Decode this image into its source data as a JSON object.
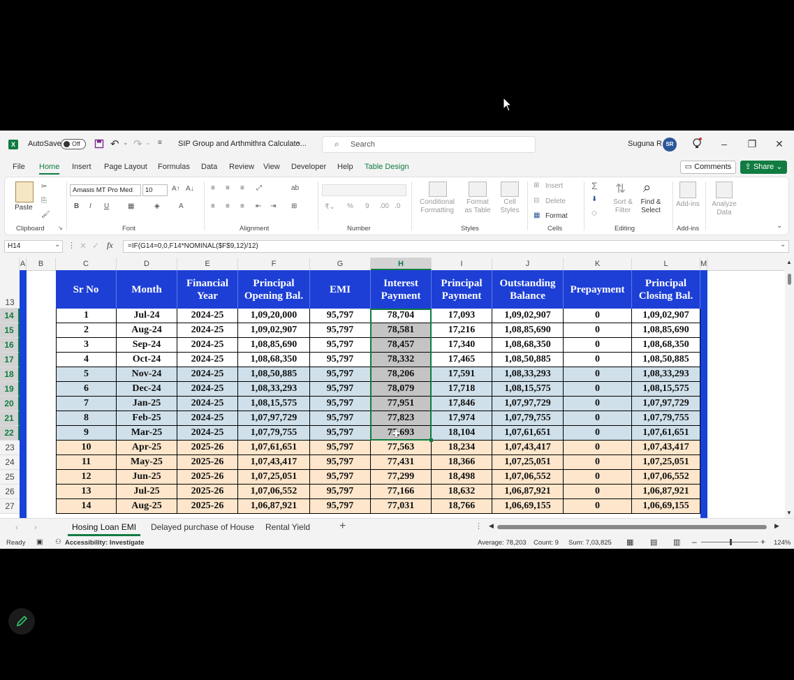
{
  "window": {
    "autosave_label": "AutoSave",
    "autosave_state": "Off",
    "file_title": "SIP Group and Arthmithra Calculato...",
    "search_placeholder": "Search",
    "user_name": "Suguna R",
    "user_initials": "SR"
  },
  "menu": {
    "items": [
      "File",
      "Home",
      "Insert",
      "Page Layout",
      "Formulas",
      "Data",
      "Review",
      "View",
      "Developer",
      "Help",
      "Table Design"
    ],
    "comments": "Comments",
    "share": "Share"
  },
  "ribbon": {
    "clipboard": {
      "label": "Clipboard",
      "paste": "Paste"
    },
    "font": {
      "label": "Font",
      "font_name": "Amasis MT Pro Med",
      "font_size": "10"
    },
    "alignment": {
      "label": "Alignment"
    },
    "number": {
      "label": "Number"
    },
    "styles": {
      "label": "Styles",
      "conditional": "Conditional Formatting",
      "format_table": "Format as Table",
      "cell_styles": "Cell Styles"
    },
    "cells": {
      "label": "Cells",
      "insert": "Insert",
      "delete": "Delete",
      "format": "Format"
    },
    "editing": {
      "label": "Editing",
      "sort": "Sort & Filter",
      "find": "Find & Select"
    },
    "addins": {
      "label": "Add-ins",
      "addins_btn": "Add-ins",
      "analyze": "Analyze Data"
    }
  },
  "formula_bar": {
    "name_box": "H14",
    "formula": "=IF(G14=0,0,F14*NOMINAL($F$9,12)/12)"
  },
  "columns": [
    "A",
    "B",
    "C",
    "D",
    "E",
    "F",
    "G",
    "H",
    "I",
    "J",
    "K",
    "L",
    "M"
  ],
  "table": {
    "header_row": "13",
    "headers": [
      [
        "Sr No"
      ],
      [
        "Month"
      ],
      [
        "Financial",
        "Year"
      ],
      [
        "Principal",
        "Opening Bal."
      ],
      [
        "EMI"
      ],
      [
        "Interest",
        "Payment"
      ],
      [
        "Principal",
        "Payment"
      ],
      [
        "Outstanding",
        "Balance"
      ],
      [
        "Prepayment"
      ],
      [
        "Principal",
        "Closing Bal."
      ]
    ],
    "rows": [
      {
        "row": "14",
        "cells": [
          "1",
          "Jul-24",
          "2024-25",
          "1,09,20,000",
          "95,797",
          "78,704",
          "17,093",
          "1,09,02,907",
          "0",
          "1,09,02,907"
        ]
      },
      {
        "row": "15",
        "cells": [
          "2",
          "Aug-24",
          "2024-25",
          "1,09,02,907",
          "95,797",
          "78,581",
          "17,216",
          "1,08,85,690",
          "0",
          "1,08,85,690"
        ]
      },
      {
        "row": "16",
        "cells": [
          "3",
          "Sep-24",
          "2024-25",
          "1,08,85,690",
          "95,797",
          "78,457",
          "17,340",
          "1,08,68,350",
          "0",
          "1,08,68,350"
        ]
      },
      {
        "row": "17",
        "cells": [
          "4",
          "Oct-24",
          "2024-25",
          "1,08,68,350",
          "95,797",
          "78,332",
          "17,465",
          "1,08,50,885",
          "0",
          "1,08,50,885"
        ]
      },
      {
        "row": "18",
        "cells": [
          "5",
          "Nov-24",
          "2024-25",
          "1,08,50,885",
          "95,797",
          "78,206",
          "17,591",
          "1,08,33,293",
          "0",
          "1,08,33,293"
        ]
      },
      {
        "row": "19",
        "cells": [
          "6",
          "Dec-24",
          "2024-25",
          "1,08,33,293",
          "95,797",
          "78,079",
          "17,718",
          "1,08,15,575",
          "0",
          "1,08,15,575"
        ]
      },
      {
        "row": "20",
        "cells": [
          "7",
          "Jan-25",
          "2024-25",
          "1,08,15,575",
          "95,797",
          "77,951",
          "17,846",
          "1,07,97,729",
          "0",
          "1,07,97,729"
        ]
      },
      {
        "row": "21",
        "cells": [
          "8",
          "Feb-25",
          "2024-25",
          "1,07,97,729",
          "95,797",
          "77,823",
          "17,974",
          "1,07,79,755",
          "0",
          "1,07,79,755"
        ]
      },
      {
        "row": "22",
        "cells": [
          "9",
          "Mar-25",
          "2024-25",
          "1,07,79,755",
          "95,797",
          "77,693",
          "18,104",
          "1,07,61,651",
          "0",
          "1,07,61,651"
        ]
      },
      {
        "row": "23",
        "cells": [
          "10",
          "Apr-25",
          "2025-26",
          "1,07,61,651",
          "95,797",
          "77,563",
          "18,234",
          "1,07,43,417",
          "0",
          "1,07,43,417"
        ]
      },
      {
        "row": "24",
        "cells": [
          "11",
          "May-25",
          "2025-26",
          "1,07,43,417",
          "95,797",
          "77,431",
          "18,366",
          "1,07,25,051",
          "0",
          "1,07,25,051"
        ]
      },
      {
        "row": "25",
        "cells": [
          "12",
          "Jun-25",
          "2025-26",
          "1,07,25,051",
          "95,797",
          "77,299",
          "18,498",
          "1,07,06,552",
          "0",
          "1,07,06,552"
        ]
      },
      {
        "row": "26",
        "cells": [
          "13",
          "Jul-25",
          "2025-26",
          "1,07,06,552",
          "95,797",
          "77,166",
          "18,632",
          "1,06,87,921",
          "0",
          "1,06,87,921"
        ]
      },
      {
        "row": "27",
        "cells": [
          "14",
          "Aug-25",
          "2025-26",
          "1,06,87,921",
          "95,797",
          "77,031",
          "18,766",
          "1,06,69,155",
          "0",
          "1,06,69,155"
        ]
      }
    ]
  },
  "sheet_tabs": [
    "Hosing Loan EMI",
    "Delayed purchase of House",
    "Rental Yield"
  ],
  "status": {
    "ready": "Ready",
    "accessibility": "Accessibility: Investigate",
    "average": "Average: 78,203",
    "count": "Count: 9",
    "sum": "Sum: 7,03,825",
    "zoom": "124%"
  },
  "colors": {
    "accent": "#107c41",
    "table_header": "#1d3fd6",
    "row_white": "#ffffff",
    "row_blue": "#cfe0ea",
    "row_orange": "#fde6cb",
    "selection": "#c4c4c4"
  }
}
